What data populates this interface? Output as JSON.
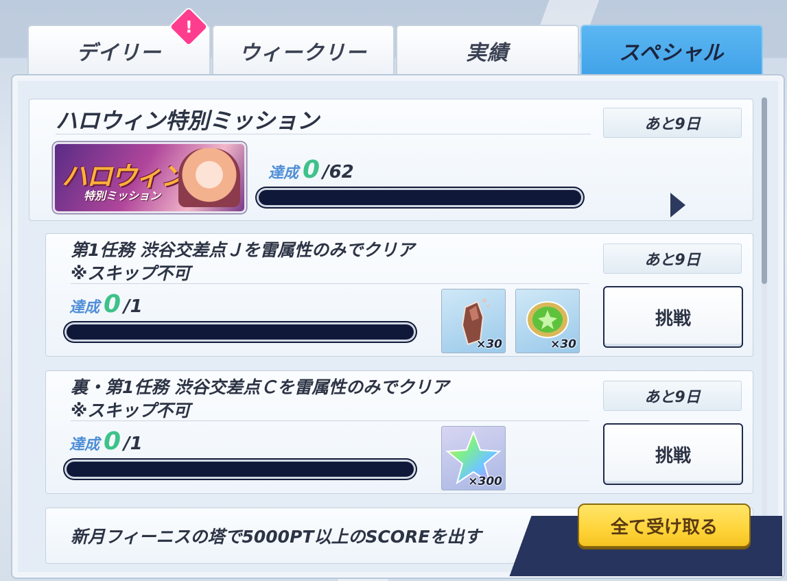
{
  "tabs": [
    {
      "label": "デイリー",
      "active": false
    },
    {
      "label": "ウィークリー",
      "active": false
    },
    {
      "label": "実績",
      "active": false
    },
    {
      "label": "スペシャル",
      "active": true
    }
  ],
  "alert_badge": "!",
  "event": {
    "title": "ハロウィン特別ミッション",
    "days_left": "あと9日",
    "banner_title": "ハロウィン",
    "banner_subtitle": "特別ミッション",
    "progress_word": "達成",
    "progress_current": "0",
    "progress_total": "/62",
    "progress_fraction": 0
  },
  "missions": [
    {
      "title_line1": "第1任務 渋谷交差点Ｊを雷属性のみでクリア",
      "title_line2": "※スキップ不可",
      "days_left": "あと9日",
      "progress_word": "達成",
      "progress_current": "0",
      "progress_total": "/1",
      "progress_fraction": 0,
      "button_label": "挑戦",
      "rewards": [
        {
          "icon": "crystal-shard-icon",
          "qty": "×30"
        },
        {
          "icon": "green-gem-icon",
          "qty": "×30"
        }
      ]
    },
    {
      "title_line1": "裏・第1任務 渋谷交差点Ｃを雷属性のみでクリア",
      "title_line2": "※スキップ不可",
      "days_left": "あと9日",
      "progress_word": "達成",
      "progress_current": "0",
      "progress_total": "/1",
      "progress_fraction": 0,
      "button_label": "挑戦",
      "rewards": [
        {
          "icon": "rainbow-star-icon",
          "qty": "×300"
        }
      ]
    },
    {
      "title_line1": "新月フィーニスの塔で5000PT以上のSCOREを出す"
    }
  ],
  "receive_all_label": "全て受け取る",
  "colors": {
    "accent_tab": "#41a2e8",
    "progress_num": "#3ec28a",
    "button_yellow": "#ffd43a"
  }
}
